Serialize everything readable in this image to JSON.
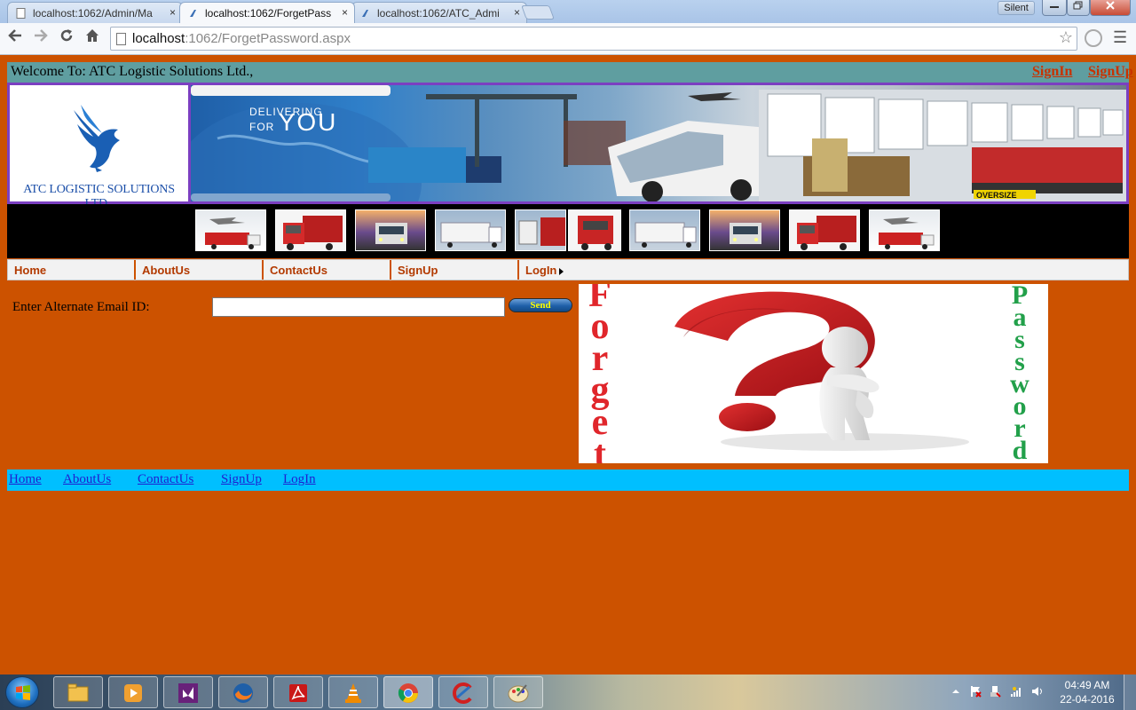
{
  "browser": {
    "tabs": [
      {
        "title": "localhost:1062/Admin/Ma"
      },
      {
        "title": "localhost:1062/ForgetPass"
      },
      {
        "title": "localhost:1062/ATC_Admi"
      }
    ],
    "tab_close_glyph": "×",
    "profile_label": "Silent",
    "url_host": "localhost",
    "url_rest": ":1062/ForgetPassword.aspx",
    "icons": [
      "back-icon",
      "forward-icon",
      "reload-icon",
      "home-icon",
      "star-icon",
      "extension-icon",
      "menu-icon"
    ]
  },
  "header": {
    "welcome_text": "Welcome To: ATC Logistic Solutions Ltd.,",
    "signin_label": "SignIn",
    "signup_label": "SignUp"
  },
  "banner": {
    "logo_text": "ATC LOGISTIC SOLUTIONS LTD.,",
    "tagline_small": "DELIVERING",
    "tagline_for": "FOR",
    "tagline_big": "YOU",
    "photo_sign": "OVERSIZE"
  },
  "menu": {
    "items": [
      {
        "label": "Home"
      },
      {
        "label": "AboutUs"
      },
      {
        "label": "ContactUs"
      },
      {
        "label": "SignUp"
      },
      {
        "label": "LogIn"
      }
    ]
  },
  "form": {
    "email_label": "Enter Alternate Email ID:",
    "email_value": "",
    "send_label": "Send"
  },
  "forget_image": {
    "left_word": "Forget",
    "right_word": "Password"
  },
  "footer": {
    "links": [
      {
        "label": "Home"
      },
      {
        "label": "AboutUs"
      },
      {
        "label": "ContactUs"
      },
      {
        "label": "SignUp"
      },
      {
        "label": "LogIn"
      }
    ]
  },
  "taskbar": {
    "time": "04:49 AM",
    "date": "22-04-2016",
    "apps": [
      "explorer",
      "media-player",
      "visual-studio",
      "firefox",
      "acrobat",
      "vlc",
      "chrome",
      "ccleaner",
      "paint"
    ]
  },
  "colors": {
    "page_bg": "#cc5200",
    "welcome_bar": "#5f9ea0",
    "footer_bar": "#00bfff",
    "link_red": "#c83200",
    "forget_red": "#e0262b",
    "password_green": "#22a04a"
  }
}
